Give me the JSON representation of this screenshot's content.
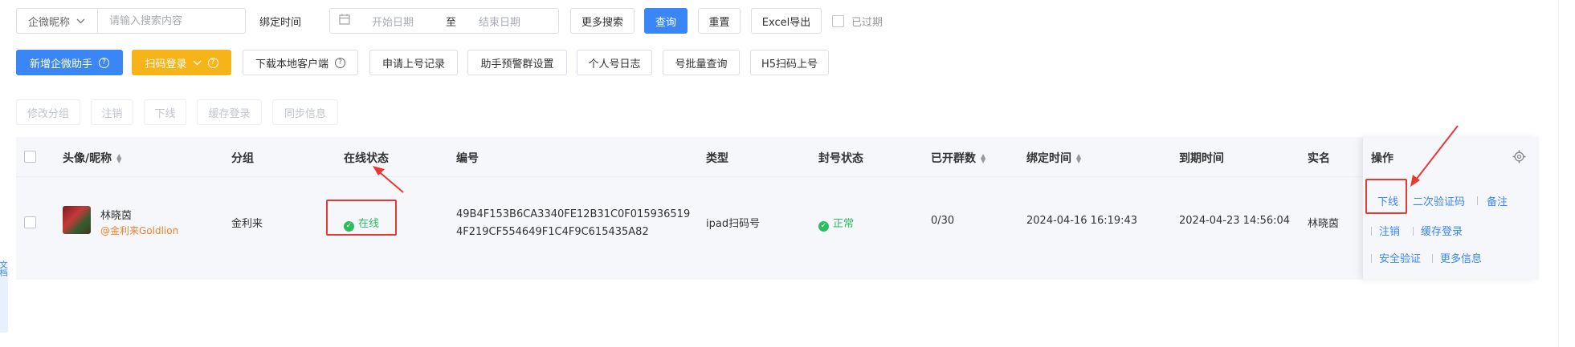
{
  "filters": {
    "nickname_select": "企微昵称",
    "search_placeholder": "请输入搜索内容",
    "bind_time_label": "绑定时间",
    "start_placeholder": "开始日期",
    "range_sep": "至",
    "end_placeholder": "结束日期",
    "more_search": "更多搜索",
    "query": "查询",
    "reset": "重置",
    "excel_export": "Excel导出",
    "expired_label": "已过期"
  },
  "toolbar": {
    "add_assistant": "新增企微助手",
    "scan_login": "扫码登录",
    "download_client": "下载本地客户端",
    "apply_records": "申请上号记录",
    "alert_group_settings": "助手预警群设置",
    "personal_log": "个人号日志",
    "batch_query": "号批量查询",
    "h5_scan": "H5扫码上号"
  },
  "batch_actions": [
    "修改分组",
    "注销",
    "下线",
    "缓存登录",
    "同步信息"
  ],
  "table": {
    "headers": {
      "avatar_nickname": "头像/昵称",
      "group": "分组",
      "online_status": "在线状态",
      "number": "编号",
      "type": "类型",
      "ban_status": "封号状态",
      "groups_opened": "已开群数",
      "bind_time": "绑定时间",
      "expire_time": "到期时间",
      "real_name": "实名",
      "operations": "操作"
    },
    "rows": [
      {
        "name": "林晓茵",
        "corp": "@金利来Goldlion",
        "group": "金利来",
        "online_status": "在线",
        "number_line1": "49B4F153B6CA3340FE12B31C0F015936519",
        "number_line2": "4F219CF554649F1C4F9C615435A82",
        "type": "ipad扫码号",
        "ban_status": "正常",
        "groups_opened": "0/30",
        "bind_time": "2024-04-16 16:19:43",
        "expire_time": "2024-04-23 14:56:04",
        "real_name": "林晓茵",
        "actions": {
          "offline": "下线",
          "second_verify": "二次验证码",
          "remark": "备注",
          "logout": "注销",
          "cache_login": "缓存登录",
          "security_verify": "安全验证",
          "more_info": "更多信息"
        }
      }
    ]
  },
  "side_tab_text": "文档",
  "colors": {
    "primary": "#3b86f6",
    "warning": "#f6b418",
    "success": "#2cbd60",
    "annotation_red": "#e53935"
  }
}
